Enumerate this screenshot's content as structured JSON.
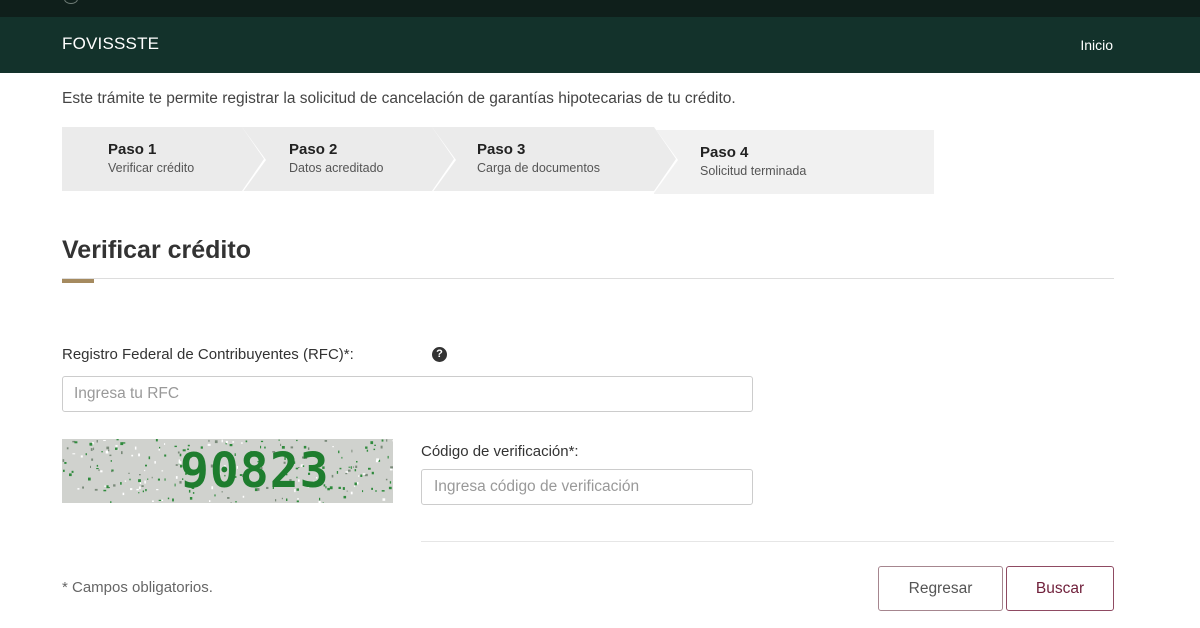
{
  "header": {
    "brand": "FOVISSSTE",
    "nav_home": "Inicio"
  },
  "intro_text": "Este trámite te permite registrar la solicitud de cancelación de garantías hipotecarias de tu crédito.",
  "steps": [
    {
      "title": "Paso 1",
      "subtitle": "Verificar crédito"
    },
    {
      "title": "Paso 2",
      "subtitle": "Datos acreditado"
    },
    {
      "title": "Paso 3",
      "subtitle": "Carga de documentos"
    },
    {
      "title": "Paso 4",
      "subtitle": "Solicitud terminada"
    }
  ],
  "section": {
    "title": "Verificar crédito"
  },
  "form": {
    "rfc_label": "Registro Federal de Contribuyentes (RFC)*:",
    "rfc_placeholder": "Ingresa tu RFC",
    "rfc_value": "",
    "captcha_text": "90823",
    "code_label": "Código de verificación*:",
    "code_placeholder": "Ingresa código de verificación",
    "code_value": "",
    "required_note": "* Campos obligatorios."
  },
  "buttons": {
    "back": "Regresar",
    "search": "Buscar"
  },
  "icons": {
    "help": "question-circle-icon"
  },
  "colors": {
    "header_bg": "#13322b",
    "topbar_bg": "#0f1f1b",
    "accent_gold": "#a58a5f",
    "button_border": "#9d2449",
    "captcha_text": "#1e7d2e"
  }
}
